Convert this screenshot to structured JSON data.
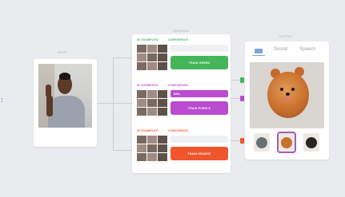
{
  "input": {
    "title": "INPUT"
  },
  "learning": {
    "title": "LEARNING",
    "classes": [
      {
        "examples_label": "30 EXAMPLES",
        "confidence_label": "CONFIDENCE",
        "confidence_value": "",
        "confidence_fraction": 0.0,
        "button_label": "TRAIN GREEN",
        "color": "#45b55a"
      },
      {
        "examples_label": "30 EXAMPLES",
        "confidence_label": "CONFIDENCE",
        "confidence_value": "99%",
        "confidence_fraction": 0.99,
        "button_label": "TRAIN PURPLE",
        "color": "#b94ccf"
      },
      {
        "examples_label": "30 EXAMPLES",
        "confidence_label": "CONFIDENCE",
        "confidence_value": "",
        "confidence_fraction": 0.0,
        "button_label": "TRAIN ORANGE",
        "color": "#f0552b"
      }
    ]
  },
  "output": {
    "title": "OUTPUT",
    "tabs": [
      {
        "label": ""
      },
      {
        "label": "Sound"
      },
      {
        "label": "Speech"
      }
    ]
  },
  "marker": {
    "symbol": ":"
  },
  "colors": {
    "green": "#45b55a",
    "purple": "#b94ccf",
    "orange": "#f0552b",
    "tab_active": "#7fa3d9"
  }
}
